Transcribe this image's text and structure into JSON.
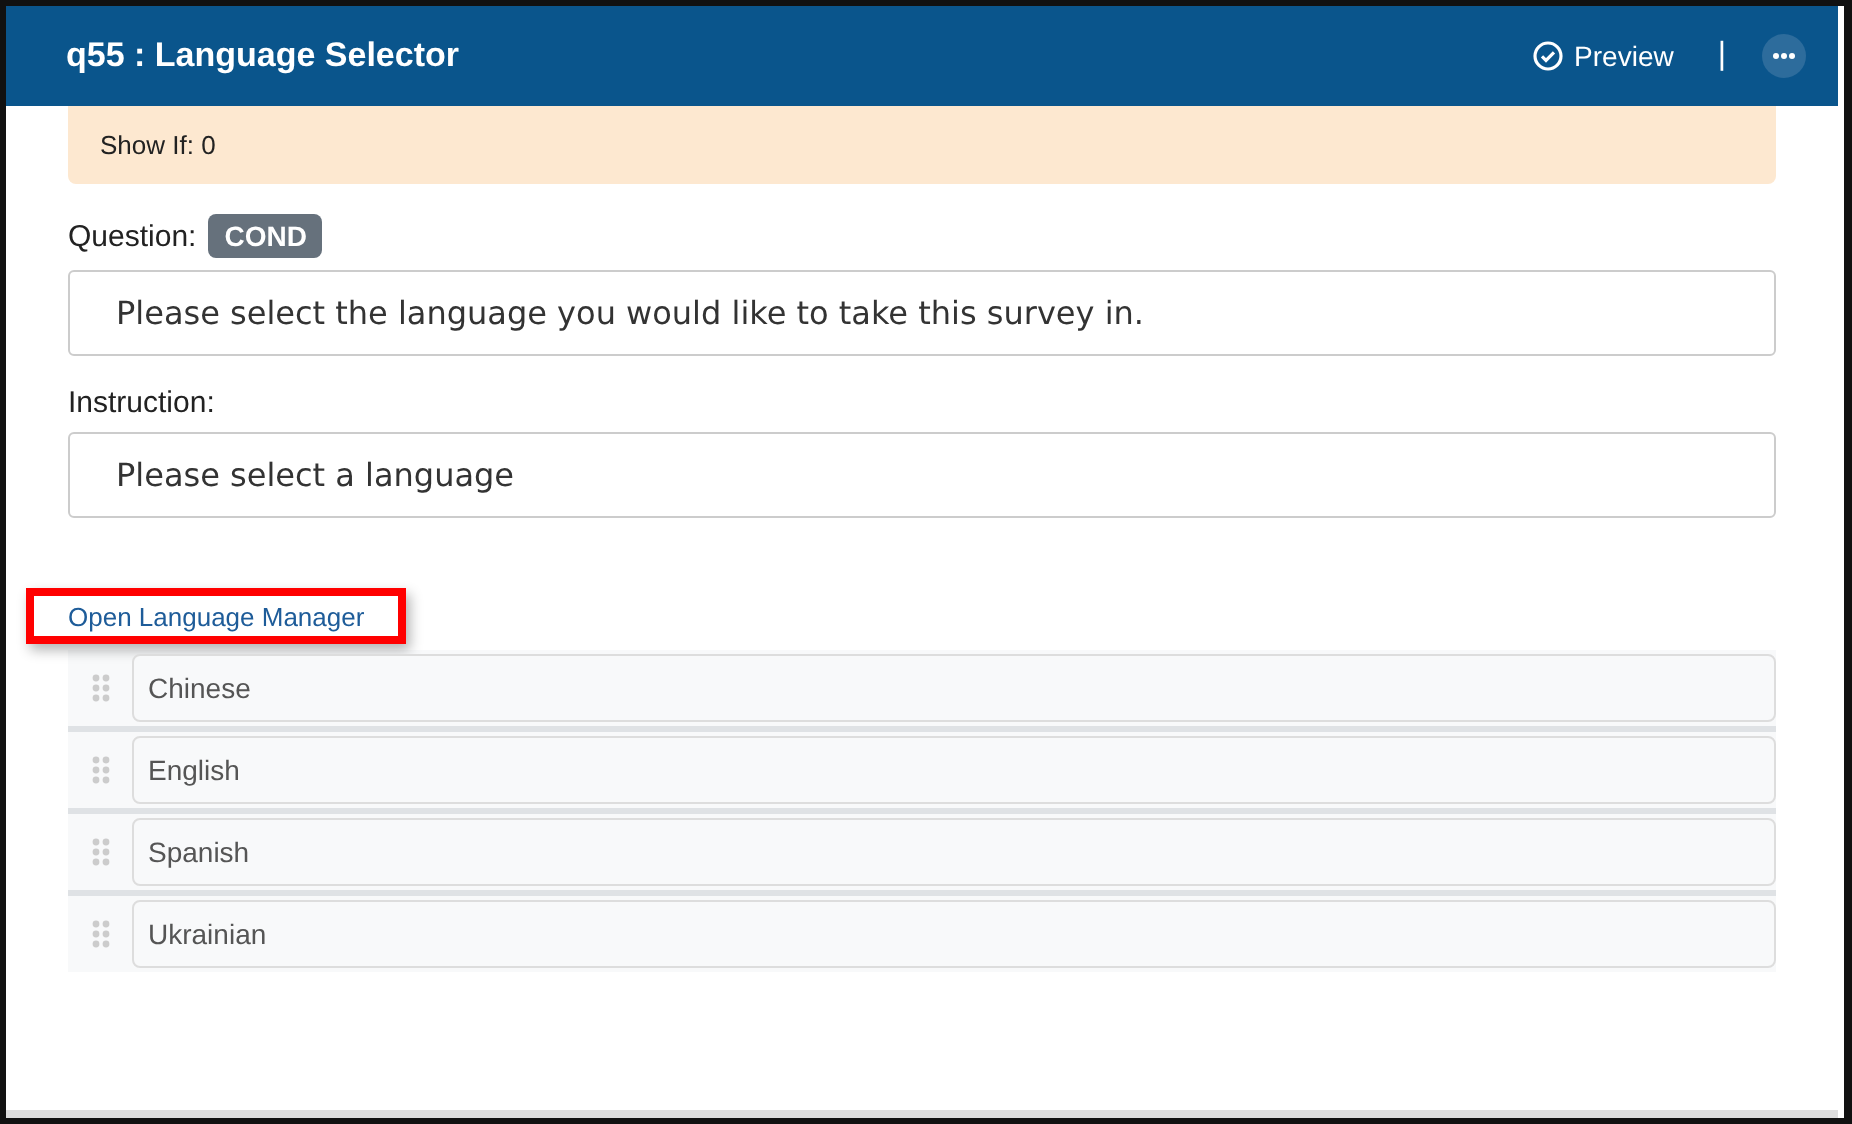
{
  "header": {
    "title": "q55 : Language Selector",
    "preview": "Preview",
    "separator": "|"
  },
  "condition": {
    "text": "Show If: 0"
  },
  "question": {
    "label": "Question:",
    "badge": "COND",
    "value": "Please select the language you would like to take this survey in."
  },
  "instruction": {
    "label": "Instruction:",
    "value": "Please select a language"
  },
  "link": {
    "text": "Open Language Manager",
    "highlighted": true
  },
  "options": [
    {
      "value": "Chinese"
    },
    {
      "value": "English"
    },
    {
      "value": "Spanish"
    },
    {
      "value": "Ukrainian"
    }
  ]
}
